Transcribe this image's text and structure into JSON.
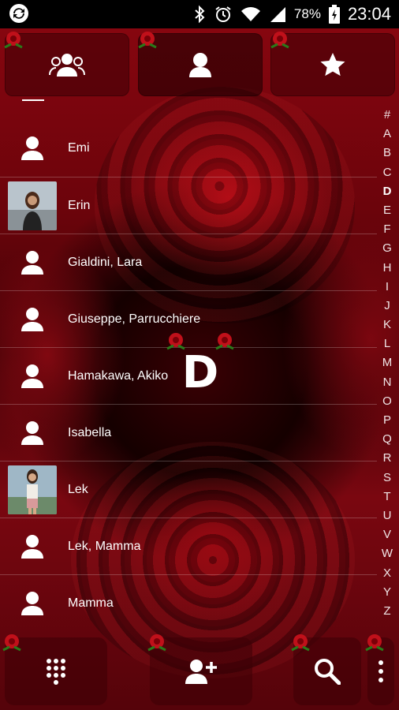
{
  "status_bar": {
    "battery_percent": "78%",
    "time": "23:04",
    "icons": [
      "sync-icon",
      "bluetooth-icon",
      "alarm-icon",
      "wifi-icon",
      "signal-icon",
      "battery-charging-icon"
    ]
  },
  "tabs": [
    {
      "name": "groups",
      "icon": "group-icon"
    },
    {
      "name": "contacts",
      "icon": "person-icon",
      "selected": true
    },
    {
      "name": "favorites",
      "icon": "star-icon"
    }
  ],
  "contacts": [
    {
      "name": "Emi",
      "avatar": "default"
    },
    {
      "name": "Erin",
      "avatar": "photo"
    },
    {
      "name": "Gialdini, Lara",
      "avatar": "default"
    },
    {
      "name": "Giuseppe, Parrucchiere",
      "avatar": "default"
    },
    {
      "name": "Hamakawa, Akiko",
      "avatar": "default"
    },
    {
      "name": "Isabella",
      "avatar": "default"
    },
    {
      "name": "Lek",
      "avatar": "photo"
    },
    {
      "name": "Lek, Mamma",
      "avatar": "default"
    },
    {
      "name": "Mamma",
      "avatar": "default"
    }
  ],
  "index_letters": [
    "#",
    "A",
    "B",
    "C",
    "D",
    "E",
    "F",
    "G",
    "H",
    "I",
    "J",
    "K",
    "L",
    "M",
    "N",
    "O",
    "P",
    "Q",
    "R",
    "S",
    "T",
    "U",
    "V",
    "W",
    "X",
    "Y",
    "Z"
  ],
  "active_letter": "D",
  "section_overlay": "D",
  "bottom_bar": [
    "dialpad-icon",
    "add-contact-icon",
    "search-icon",
    "more-vert-icon"
  ],
  "colors": {
    "theme_red": "#b00010",
    "text": "#ffffff"
  }
}
